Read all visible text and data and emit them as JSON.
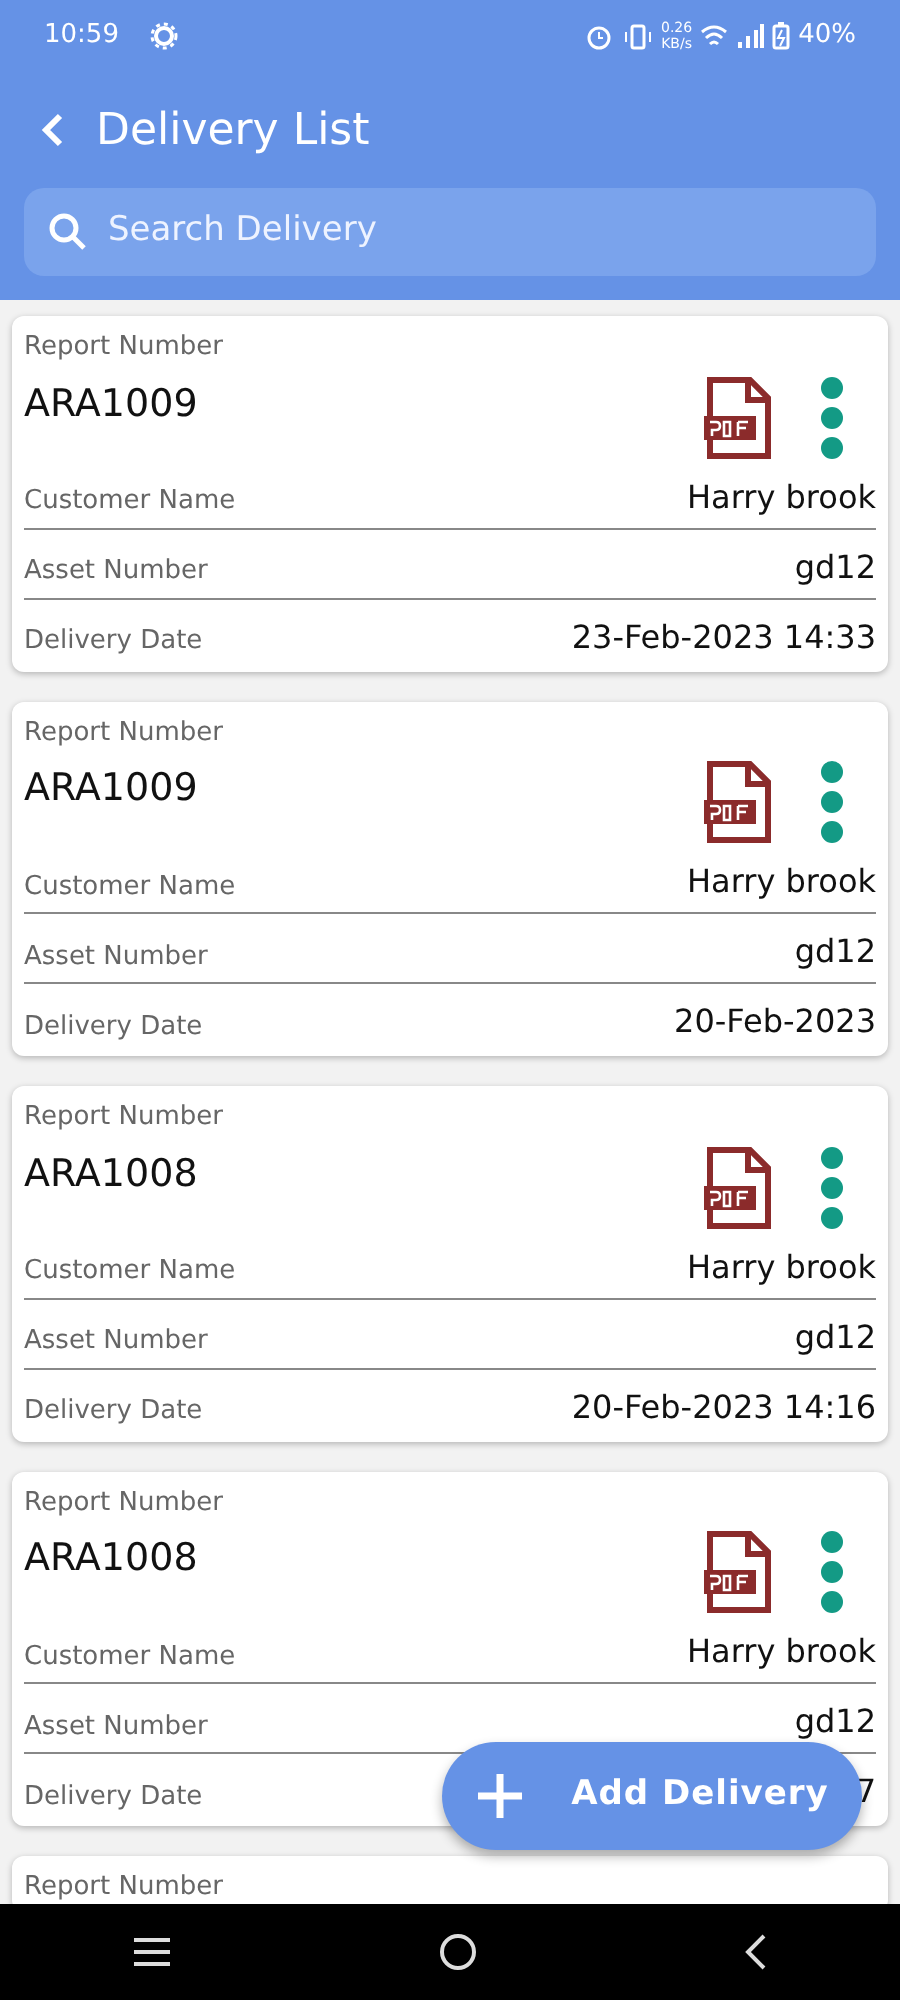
{
  "status_bar": {
    "time": "10:59",
    "speed_value": "0.26",
    "speed_unit": "KB/s",
    "battery": "40%"
  },
  "header": {
    "title": "Delivery List"
  },
  "search": {
    "placeholder": "Search Delivery"
  },
  "deliveries": [
    {
      "report_label": "Report Number",
      "report_number": "ARA1009",
      "fields": [
        {
          "label": "Customer Name",
          "value": "Harry brook"
        },
        {
          "label": "Asset Number",
          "value": "gd12"
        },
        {
          "label": "Delivery Date",
          "value": "23-Feb-2023 14:33"
        }
      ]
    },
    {
      "report_label": "Report Number",
      "report_number": "ARA1009",
      "fields": [
        {
          "label": "Customer Name",
          "value": "Harry brook"
        },
        {
          "label": "Asset Number",
          "value": "gd12"
        },
        {
          "label": "Delivery Date",
          "value": "20-Feb-2023"
        }
      ]
    },
    {
      "report_label": "Report Number",
      "report_number": "ARA1008",
      "fields": [
        {
          "label": "Customer Name",
          "value": "Harry brook"
        },
        {
          "label": "Asset Number",
          "value": "gd12"
        },
        {
          "label": "Delivery Date",
          "value": "20-Feb-2023 14:16"
        }
      ]
    },
    {
      "report_label": "Report Number",
      "report_number": "ARA1008",
      "fields": [
        {
          "label": "Customer Name",
          "value": "Harry brook"
        },
        {
          "label": "Asset Number",
          "value": "gd12"
        },
        {
          "label": "Delivery Date",
          "value": "7"
        }
      ]
    },
    {
      "report_label": "Report Number"
    }
  ],
  "fab": {
    "label": "Add Delivery"
  }
}
